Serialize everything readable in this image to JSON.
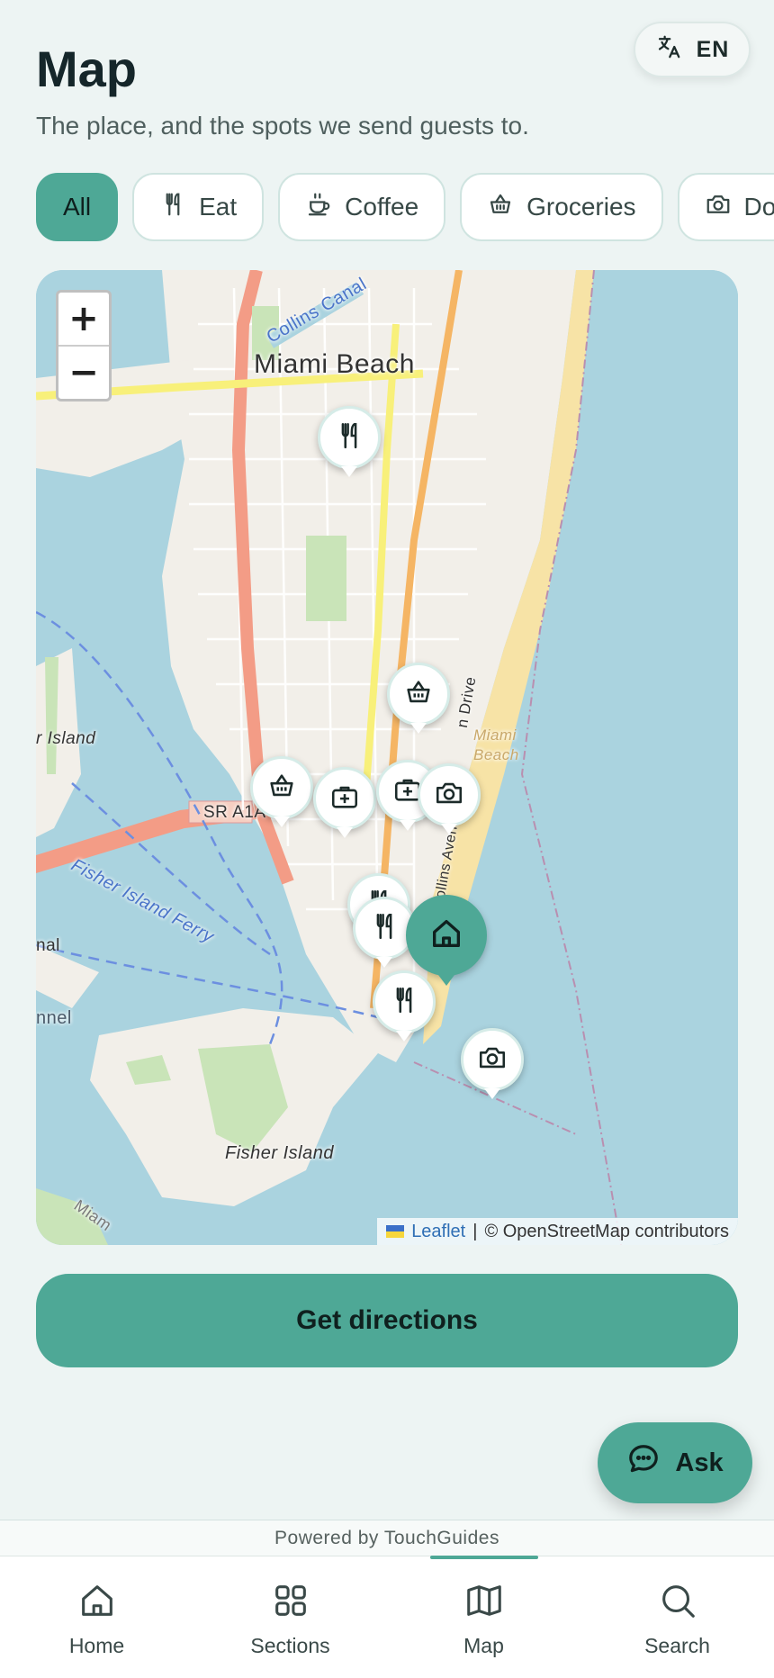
{
  "header": {
    "title": "Map",
    "subtitle": "The place, and the spots we send guests to.",
    "language": {
      "label": "EN",
      "icon": "translate-icon"
    }
  },
  "filters": [
    {
      "label": "All",
      "icon": null,
      "active": true
    },
    {
      "label": "Eat",
      "icon": "fork-knife-icon",
      "active": false
    },
    {
      "label": "Coffee",
      "icon": "coffee-cup-icon",
      "active": false
    },
    {
      "label": "Groceries",
      "icon": "basket-icon",
      "active": false
    },
    {
      "label": "Do",
      "icon": "camera-icon",
      "active": false
    }
  ],
  "map": {
    "zoom_in": "+",
    "zoom_out": "−",
    "labels": {
      "city": "Miami Beach",
      "canal": "Collins Canal",
      "island_left": "r Island",
      "road": "SR A1A",
      "beach": "Miami Beach",
      "ferry": "Fisher Island Ferry",
      "fisher_island": "Fisher Island",
      "drive": "n Drive",
      "avenue": "Collins Avenu",
      "channel": "nnel",
      "nal": "nal",
      "miami_corner": "Miam"
    },
    "attribution": {
      "leaflet": "Leaflet",
      "separator": "|",
      "osm": "© OpenStreetMap contributors"
    },
    "markers": [
      "fork-knife-icon",
      "basket-icon",
      "basket-icon",
      "medical-kit-icon",
      "medical-kit-icon",
      "camera-icon",
      "fork-knife-icon",
      "fork-knife-icon",
      "home-icon",
      "fork-knife-icon",
      "camera-icon"
    ]
  },
  "actions": {
    "directions": "Get directions",
    "ask": "Ask"
  },
  "footer": {
    "powered_by": "Powered by TouchGuides"
  },
  "tabs": [
    {
      "label": "Home",
      "icon": "home-outline-icon",
      "active": false
    },
    {
      "label": "Sections",
      "icon": "grid-icon",
      "active": false
    },
    {
      "label": "Map",
      "icon": "map-icon",
      "active": true
    },
    {
      "label": "Search",
      "icon": "search-icon",
      "active": false
    }
  ],
  "colors": {
    "accent": "#4ea896",
    "background": "#edf4f3",
    "water": "#aad3df",
    "land": "#f2efe9"
  }
}
